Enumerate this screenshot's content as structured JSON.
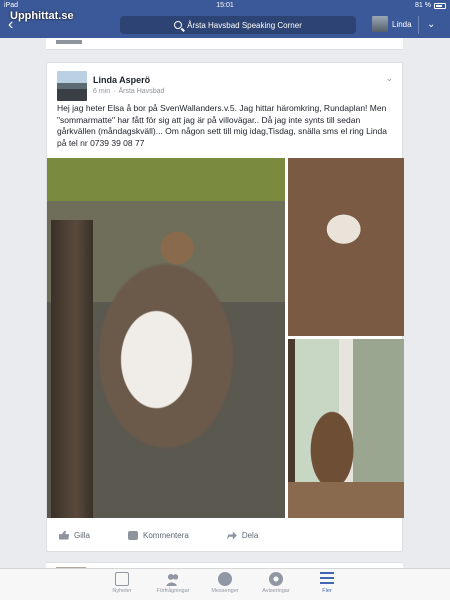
{
  "status_bar": {
    "device": "iPad",
    "time": "15:01",
    "battery": "81 %",
    "battery_level": 0.81
  },
  "watermark": "Upphittat.se",
  "nav": {
    "search_text": "Årsta Havsbad Speaking Corner",
    "user_name": "Linda"
  },
  "post": {
    "author": "Linda Asperö",
    "time": "6 min",
    "separator": "·",
    "location": "Årsta Havsbad",
    "text": "Hej jag heter Elsa å bor på SvenWallanders.v.5. Jag hittar häromkring, Rundaplan! Men \"sommarmatte\" har fått för sig att jag är på villovägar.. Då jag inte synts till sedan gårkvällen (måndagskväll)... Om någon sett till mig idag,Tisdag, snälla sms el ring Linda på tel nr 0739 39 08 77",
    "actions": {
      "like": "Gilla",
      "comment": "Kommentera",
      "share": "Dela"
    }
  },
  "tabbar": {
    "news": "Nyheter",
    "friends": "Förfrågningar",
    "messenger": "Messenger",
    "notifications": "Aviseringar",
    "more": "Fler"
  },
  "colors": {
    "brand": "#3b5998",
    "active_tab": "#4267b2"
  }
}
